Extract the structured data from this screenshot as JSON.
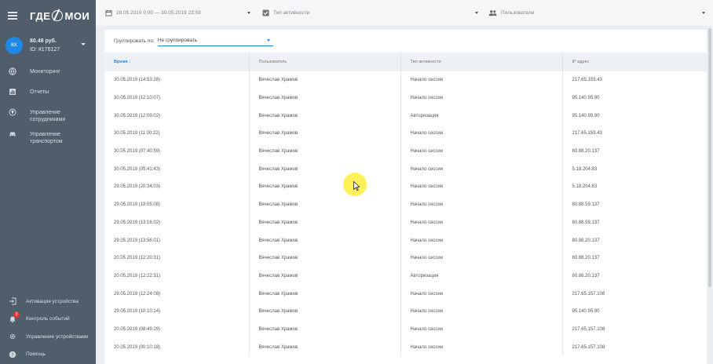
{
  "app": {
    "logo_text_1": "ГДЕ",
    "logo_text_2": "МОИ",
    "accent_color": "#1e88e5",
    "sidebar_color": "#4f5e6a"
  },
  "account": {
    "avatar_initials": "ВХ",
    "balance": "80.48 руб.",
    "id": "ID: #176127"
  },
  "nav": {
    "items": [
      {
        "label": "Мониторинг",
        "icon": "globe-icon"
      },
      {
        "label": "Отчеты",
        "icon": "chart-icon"
      },
      {
        "label": "Управление сотрудниками",
        "icon": "location-icon"
      },
      {
        "label": "Управление транспортом",
        "icon": "car-icon"
      }
    ],
    "bottom": [
      {
        "label": "Активация устройства",
        "icon": "login-icon"
      },
      {
        "label": "Контроль событий",
        "icon": "bell-icon",
        "badge": "3"
      },
      {
        "label": "Управление устройствами",
        "icon": "gear-icon"
      },
      {
        "label": "Помощь",
        "icon": "help-icon"
      }
    ]
  },
  "filters": {
    "date_range": "28.05.2019 0:00 — 30.05.2019 23:59",
    "activity_type": "Тип активности",
    "users": "Пользователи"
  },
  "grouping": {
    "label": "Группировать по:",
    "value": "Не группировать"
  },
  "table": {
    "headers": [
      "Время",
      "Пользователь",
      "Тип активности",
      "IP адрес"
    ],
    "rows": [
      [
        "30.05.2019 (14:53:28)",
        "Вячеслав Храмов",
        "Начало сессии",
        "217.65.159.43"
      ],
      [
        "30.05.2019 (12:10:07)",
        "Вячеслав Храмов",
        "Начало сессии",
        "95.140.95.90"
      ],
      [
        "30.05.2019 (12:09:02)",
        "Вячеслав Храмов",
        "Авторизация",
        "95.140.95.90"
      ],
      [
        "30.05.2019 (11:00:22)",
        "Вячеслав Храмов",
        "Начало сессии",
        "217.65.159.43"
      ],
      [
        "30.05.2019 (07:40:59)",
        "Вячеслав Храмов",
        "Начало сессии",
        "80.88.20.137"
      ],
      [
        "30.05.2019 (05:41:43)",
        "Вячеслав Храмов",
        "Начало сессии",
        "5.18.204.83"
      ],
      [
        "29.05.2019 (20:34:03)",
        "Вячеслав Храмов",
        "Начало сессии",
        "5.18.204.83"
      ],
      [
        "29.05.2019 (19:05:08)",
        "Вячеслав Храмов",
        "Начало сессии",
        "80.88.59.137"
      ],
      [
        "29.05.2019 (13:16:02)",
        "Вячеслав Храмов",
        "Начало сессии",
        "80.88.59.137"
      ],
      [
        "29.05.2019 (13:56:01)",
        "Вячеслав Храмов",
        "Начало сессии",
        "80.88.20.137"
      ],
      [
        "20.05.2019 (12:20:31)",
        "Вячеслав Храмов",
        "Начало сессии",
        "80.88.20.137"
      ],
      [
        "20.05.2019 (12:22:31)",
        "Вячеслав Храмов",
        "Авторизация",
        "80.88.20.137"
      ],
      [
        "29.05.2019 (12:24:08)",
        "Вячеслав Храмов",
        "Начало сессии",
        "217.65.157.108"
      ],
      [
        "29.05.2019 (10:10:14)",
        "Вячеслав Храмов",
        "Начало сессии",
        "95.140.95.90"
      ],
      [
        "20.05.2019 (08:49:29)",
        "Вячеслав Храмов",
        "Начало сессии",
        "217.65.157.108"
      ],
      [
        "20.05.2019 (00:10:18)",
        "Вячеслав Храмов",
        "Начало сессии",
        "217.65.157.108"
      ]
    ]
  }
}
